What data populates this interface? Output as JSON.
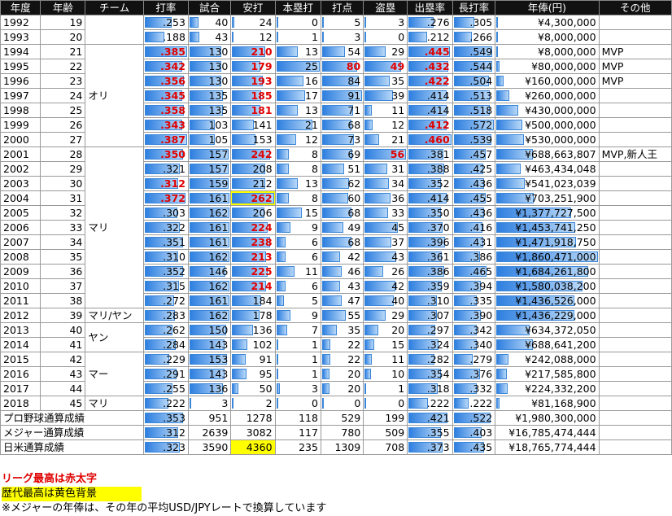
{
  "headers": [
    "年度",
    "年齢",
    "チーム",
    "打率",
    "試合",
    "安打",
    "本塁打",
    "打点",
    "盗塁",
    "出塁率",
    "長打率",
    "年俸(円)",
    "その他"
  ],
  "rows": [
    {
      "year": "1992",
      "age": "19",
      "avg": ".253",
      "g": "40",
      "h": "24",
      "hr": "0",
      "rbi": "5",
      "sb": "3",
      "obp": ".276",
      "slg": ".305",
      "salary": "¥4,300,000",
      "other": ""
    },
    {
      "year": "1993",
      "age": "20",
      "avg": ".188",
      "g": "43",
      "h": "12",
      "hr": "1",
      "rbi": "3",
      "sb": "0",
      "obp": ".212",
      "slg": ".266",
      "salary": "¥8,000,000",
      "other": ""
    },
    {
      "year": "1994",
      "age": "21",
      "avg": ".385",
      "g": "130",
      "h": "210",
      "hr": "13",
      "rbi": "54",
      "sb": "29",
      "obp": ".445",
      "slg": ".549",
      "salary": "¥8,000,000",
      "other": "MVP"
    },
    {
      "year": "1995",
      "age": "22",
      "avg": ".342",
      "g": "130",
      "h": "179",
      "hr": "25",
      "rbi": "80",
      "sb": "49",
      "obp": ".432",
      "slg": ".544",
      "salary": "¥80,000,000",
      "other": "MVP"
    },
    {
      "year": "1996",
      "age": "23",
      "avg": ".356",
      "g": "130",
      "h": "193",
      "hr": "16",
      "rbi": "84",
      "sb": "35",
      "obp": ".422",
      "slg": ".504",
      "salary": "¥160,000,000",
      "other": "MVP"
    },
    {
      "year": "1997",
      "age": "24",
      "avg": ".345",
      "g": "135",
      "h": "185",
      "hr": "17",
      "rbi": "91",
      "sb": "39",
      "obp": ".414",
      "slg": ".513",
      "salary": "¥260,000,000",
      "other": ""
    },
    {
      "year": "1998",
      "age": "25",
      "avg": ".358",
      "g": "135",
      "h": "181",
      "hr": "13",
      "rbi": "71",
      "sb": "11",
      "obp": ".414",
      "slg": ".518",
      "salary": "¥430,000,000",
      "other": ""
    },
    {
      "year": "1999",
      "age": "26",
      "avg": ".343",
      "g": "103",
      "h": "141",
      "hr": "21",
      "rbi": "68",
      "sb": "12",
      "obp": ".412",
      "slg": ".572",
      "salary": "¥500,000,000",
      "other": ""
    },
    {
      "year": "2000",
      "age": "27",
      "avg": ".387",
      "g": "105",
      "h": "153",
      "hr": "12",
      "rbi": "73",
      "sb": "21",
      "obp": ".460",
      "slg": ".539",
      "salary": "¥530,000,000",
      "other": ""
    },
    {
      "year": "2001",
      "age": "28",
      "avg": ".350",
      "g": "157",
      "h": "242",
      "hr": "8",
      "rbi": "69",
      "sb": "56",
      "obp": ".381",
      "slg": ".457",
      "salary": "¥688,663,807",
      "other": "MVP,新人王"
    },
    {
      "year": "2002",
      "age": "29",
      "avg": ".321",
      "g": "157",
      "h": "208",
      "hr": "8",
      "rbi": "51",
      "sb": "31",
      "obp": ".388",
      "slg": ".425",
      "salary": "¥463,434,048",
      "other": ""
    },
    {
      "year": "2003",
      "age": "30",
      "avg": ".312",
      "g": "159",
      "h": "212",
      "hr": "13",
      "rbi": "62",
      "sb": "34",
      "obp": ".352",
      "slg": ".436",
      "salary": "¥541,023,039",
      "other": ""
    },
    {
      "year": "2004",
      "age": "31",
      "avg": ".372",
      "g": "161",
      "h": "262",
      "hr": "8",
      "rbi": "60",
      "sb": "36",
      "obp": ".414",
      "slg": ".455",
      "salary": "¥703,251,900",
      "other": ""
    },
    {
      "year": "2005",
      "age": "32",
      "avg": ".303",
      "g": "162",
      "h": "206",
      "hr": "15",
      "rbi": "68",
      "sb": "33",
      "obp": ".350",
      "slg": ".436",
      "salary": "¥1,377,727,500",
      "other": ""
    },
    {
      "year": "2006",
      "age": "33",
      "avg": ".322",
      "g": "161",
      "h": "224",
      "hr": "9",
      "rbi": "49",
      "sb": "45",
      "obp": ".370",
      "slg": ".416",
      "salary": "¥1,453,741,250",
      "other": ""
    },
    {
      "year": "2007",
      "age": "34",
      "avg": ".351",
      "g": "161",
      "h": "238",
      "hr": "6",
      "rbi": "68",
      "sb": "37",
      "obp": ".396",
      "slg": ".431",
      "salary": "¥1,471,918,750",
      "other": ""
    },
    {
      "year": "2008",
      "age": "35",
      "avg": ".310",
      "g": "162",
      "h": "213",
      "hr": "6",
      "rbi": "42",
      "sb": "43",
      "obp": ".361",
      "slg": ".386",
      "salary": "¥1,860,471,000",
      "other": ""
    },
    {
      "year": "2009",
      "age": "36",
      "avg": ".352",
      "g": "146",
      "h": "225",
      "hr": "11",
      "rbi": "46",
      "sb": "26",
      "obp": ".386",
      "slg": ".465",
      "salary": "¥1,684,261,800",
      "other": ""
    },
    {
      "year": "2010",
      "age": "37",
      "avg": ".315",
      "g": "162",
      "h": "214",
      "hr": "6",
      "rbi": "43",
      "sb": "42",
      "obp": ".359",
      "slg": ".394",
      "salary": "¥1,580,038,200",
      "other": ""
    },
    {
      "year": "2011",
      "age": "38",
      "avg": ".272",
      "g": "161",
      "h": "184",
      "hr": "5",
      "rbi": "47",
      "sb": "40",
      "obp": ".310",
      "slg": ".335",
      "salary": "¥1,436,526,000",
      "other": ""
    },
    {
      "year": "2012",
      "age": "39",
      "avg": ".283",
      "g": "162",
      "h": "178",
      "hr": "9",
      "rbi": "55",
      "sb": "29",
      "obp": ".307",
      "slg": ".390",
      "salary": "¥1,436,229,000",
      "other": ""
    },
    {
      "year": "2013",
      "age": "40",
      "avg": ".262",
      "g": "150",
      "h": "136",
      "hr": "7",
      "rbi": "35",
      "sb": "20",
      "obp": ".297",
      "slg": ".342",
      "salary": "¥634,372,050",
      "other": ""
    },
    {
      "year": "2014",
      "age": "41",
      "avg": ".284",
      "g": "143",
      "h": "102",
      "hr": "1",
      "rbi": "22",
      "sb": "15",
      "obp": ".324",
      "slg": ".340",
      "salary": "¥688,641,200",
      "other": ""
    },
    {
      "year": "2015",
      "age": "42",
      "avg": ".229",
      "g": "153",
      "h": "91",
      "hr": "1",
      "rbi": "22",
      "sb": "11",
      "obp": ".282",
      "slg": ".279",
      "salary": "¥242,088,000",
      "other": ""
    },
    {
      "year": "2016",
      "age": "43",
      "avg": ".291",
      "g": "143",
      "h": "95",
      "hr": "1",
      "rbi": "20",
      "sb": "10",
      "obp": ".354",
      "slg": ".376",
      "salary": "¥217,585,800",
      "other": ""
    },
    {
      "year": "2017",
      "age": "44",
      "avg": ".255",
      "g": "136",
      "h": "50",
      "hr": "3",
      "rbi": "20",
      "sb": "1",
      "obp": ".318",
      "slg": ".332",
      "salary": "¥224,332,200",
      "other": ""
    },
    {
      "year": "2018",
      "age": "45",
      "avg": ".222",
      "g": "3",
      "h": "2",
      "hr": "0",
      "rbi": "0",
      "sb": "0",
      "obp": ".222",
      "slg": ".222",
      "salary": "¥81,168,900",
      "other": ""
    }
  ],
  "teams": [
    {
      "name": "",
      "span": 2
    },
    {
      "name": "オリ",
      "span": 7
    },
    {
      "name": "マリ",
      "span": 11
    },
    {
      "name": "マリ/ヤン",
      "span": 1
    },
    {
      "name": "ヤン",
      "span": 2
    },
    {
      "name": "マー",
      "span": 3
    },
    {
      "name": "マリ",
      "span": 1
    }
  ],
  "totals": [
    {
      "label": "プロ野球通算成績",
      "avg": ".353",
      "g": "951",
      "h": "1278",
      "hr": "118",
      "rbi": "529",
      "sb": "199",
      "obp": ".421",
      "slg": ".522",
      "salary": "¥1,980,300,000"
    },
    {
      "label": "メジャー通算成績",
      "avg": ".312",
      "g": "2639",
      "h": "3082",
      "hr": "117",
      "rbi": "780",
      "sb": "509",
      "obp": ".355",
      "slg": ".403",
      "salary": "¥16,785,474,444"
    },
    {
      "label": "日米通算成績",
      "avg": ".323",
      "g": "3590",
      "h": "4360",
      "hr": "235",
      "rbi": "1309",
      "sb": "708",
      "obp": ".373",
      "slg": ".435",
      "salary": "¥18,765,774,444"
    }
  ],
  "highlights": {
    "league_best": [
      "2-avg",
      "2-h",
      "2-obp",
      "3-avg",
      "3-h",
      "3-rbi",
      "3-sb",
      "3-obp",
      "4-avg",
      "4-h",
      "4-obp",
      "5-avg",
      "5-h",
      "6-avg",
      "6-h",
      "7-avg",
      "7-obp",
      "8-avg",
      "8-obp",
      "9-avg",
      "9-h",
      "9-sb",
      "11-avg",
      "12-avg",
      "12-h",
      "14-h",
      "15-h",
      "16-h",
      "17-h",
      "18-h"
    ],
    "history_best": [
      "12-h",
      "t2-h"
    ]
  },
  "bar_max": {
    "avg": 0.387,
    "g": 162,
    "h": 262,
    "hr": 25,
    "rbi": 91,
    "sb": 56,
    "obp": 0.46,
    "slg": 0.572,
    "salary": 1860471000
  },
  "notes": {
    "legend_bold": "リーグ最高は赤太字",
    "legend_yellow": "歴代最高は黄色背景",
    "footnote": "※メジャーの年俸は、その年の平均USD/JPYレートで換算しています"
  },
  "colors": {
    "header_bg": "#111111",
    "bar": "#2e7fe0",
    "best_text": "#e00000",
    "history_bg": "#ffff00"
  }
}
